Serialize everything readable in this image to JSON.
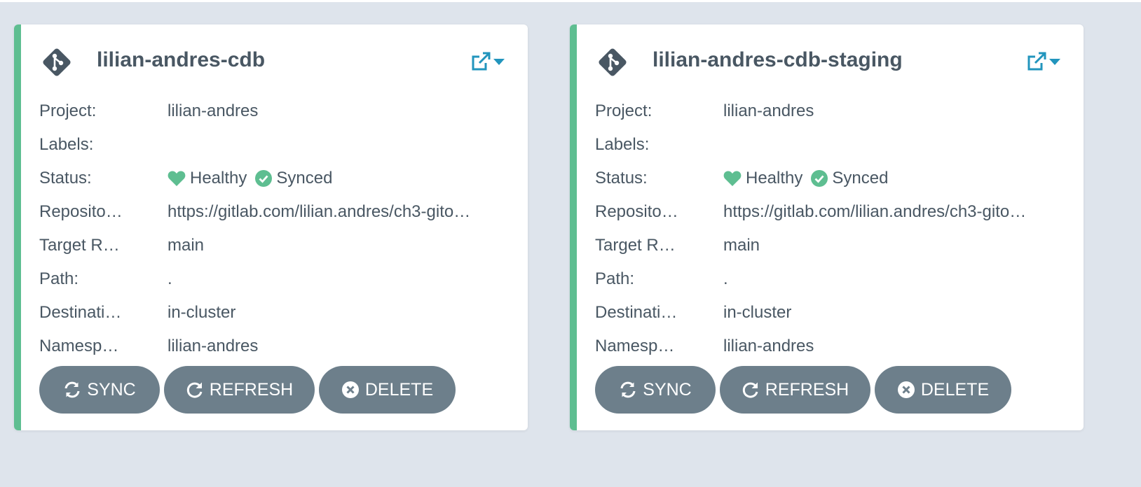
{
  "colors": {
    "background": "#dee4ec",
    "card": "#ffffff",
    "healthy_stripe": "#5ebe91",
    "status_green": "#18be94",
    "link_teal": "#2295bd",
    "button": "#6d7f8b",
    "text": "#495763"
  },
  "labels": {
    "project": "Project:",
    "labels": "Labels:",
    "status": "Status:",
    "repository": "Reposito…",
    "target_revision": "Target R…",
    "path": "Path:",
    "destination": "Destinati…",
    "namespace": "Namesp…"
  },
  "buttons": {
    "sync": "SYNC",
    "refresh": "REFRESH",
    "delete": "DELETE"
  },
  "apps": [
    {
      "name": "lilian-andres-cdb",
      "project": "lilian-andres",
      "labels": "",
      "health": "Healthy",
      "sync": "Synced",
      "repository": "https://gitlab.com/lilian.andres/ch3-gito…",
      "target_revision": "main",
      "path": ".",
      "destination": "in-cluster",
      "namespace": "lilian-andres"
    },
    {
      "name": "lilian-andres-cdb-staging",
      "project": "lilian-andres",
      "labels": "",
      "health": "Healthy",
      "sync": "Synced",
      "repository": "https://gitlab.com/lilian.andres/ch3-gito…",
      "target_revision": "main",
      "path": ".",
      "destination": "in-cluster",
      "namespace": "lilian-andres"
    }
  ],
  "icons": {
    "repo": "git-icon",
    "external_link": "external-link-icon",
    "menu": "caret-down-icon",
    "health": "heart-icon",
    "sync_status": "check-circle-icon",
    "sync": "sync-icon",
    "refresh": "redo-icon",
    "delete": "times-circle-icon"
  }
}
